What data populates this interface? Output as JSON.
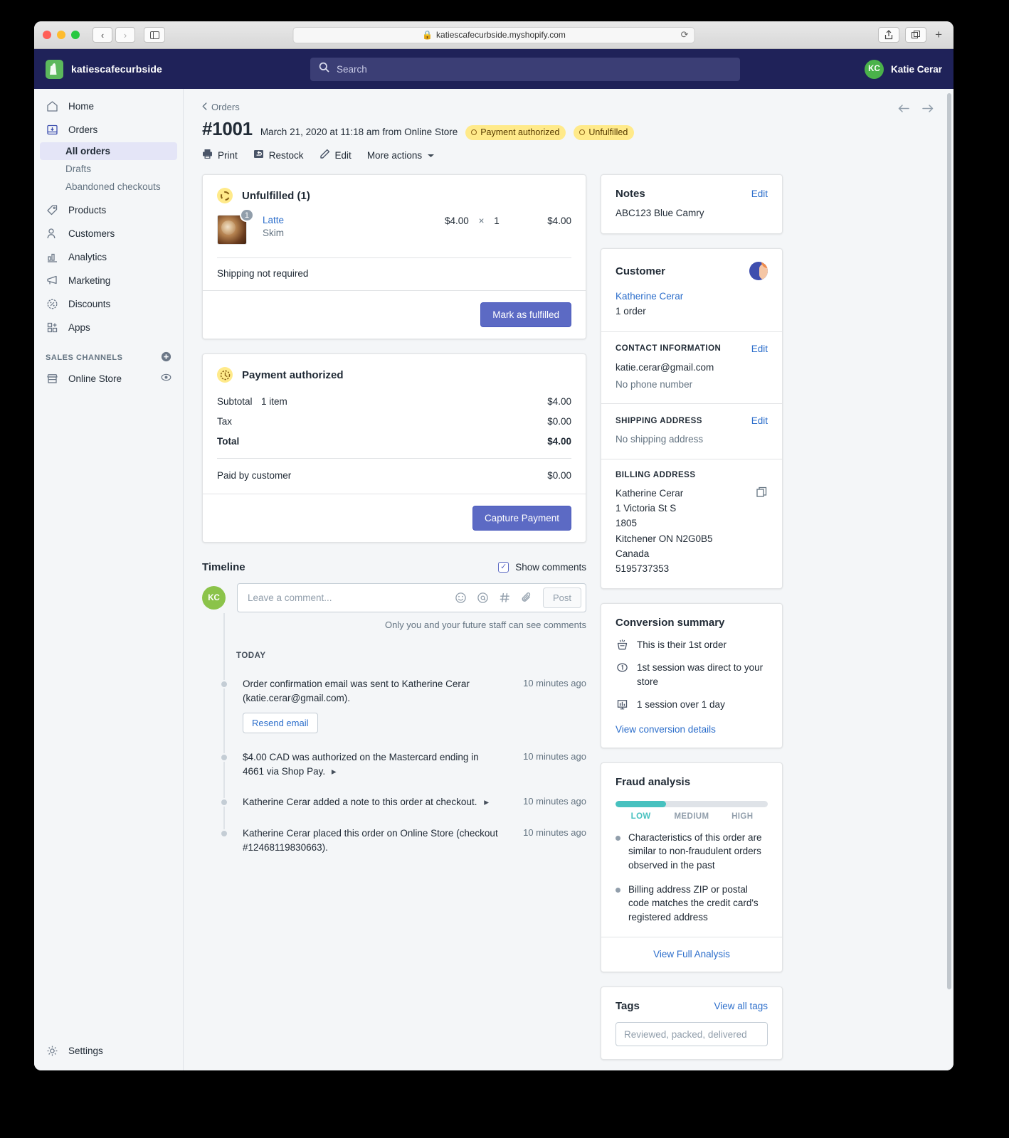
{
  "browser": {
    "url": "katiescafecurbside.myshopify.com",
    "lock_icon": "lock-icon",
    "reload_icon": "reload-icon",
    "back_icon": "chevron-left-icon",
    "forward_icon": "chevron-right-icon",
    "sidebar_icon": "sidebar-toggle-icon",
    "share_icon": "share-icon",
    "tabs_icon": "tab-overview-icon",
    "new_tab_icon": "plus-icon"
  },
  "topbar": {
    "store_name": "katiescafecurbside",
    "search_placeholder": "Search",
    "search_icon": "search-icon",
    "user_initials": "KC",
    "user_name": "Katie Cerar",
    "logo_icon": "shopify-bag-icon"
  },
  "sidebar": {
    "items": [
      {
        "label": "Home",
        "icon": "home-icon"
      },
      {
        "label": "Orders",
        "icon": "orders-inbox-icon"
      },
      {
        "label": "Products",
        "icon": "tag-icon"
      },
      {
        "label": "Customers",
        "icon": "person-icon"
      },
      {
        "label": "Analytics",
        "icon": "bar-chart-icon"
      },
      {
        "label": "Marketing",
        "icon": "megaphone-icon"
      },
      {
        "label": "Discounts",
        "icon": "discount-badge-icon"
      },
      {
        "label": "Apps",
        "icon": "apps-grid-icon"
      }
    ],
    "sub_items": [
      {
        "label": "All orders",
        "active": true
      },
      {
        "label": "Drafts",
        "active": false
      },
      {
        "label": "Abandoned checkouts",
        "active": false
      }
    ],
    "sales_channels_label": "SALES CHANNELS",
    "add_channel_icon": "plus-circle-icon",
    "online_store": {
      "label": "Online Store",
      "icon": "storefront-icon",
      "action_icon": "eye-icon"
    },
    "settings": {
      "label": "Settings",
      "icon": "gear-icon"
    }
  },
  "order": {
    "breadcrumb": "Orders",
    "breadcrumb_icon": "chevron-left-icon",
    "number": "#1001",
    "meta": "March 21, 2020 at 11:18 am from Online Store",
    "badges": [
      {
        "label": "Payment authorized"
      },
      {
        "label": "Unfulfilled"
      }
    ],
    "actions": [
      {
        "label": "Print",
        "icon": "printer-icon"
      },
      {
        "label": "Restock",
        "icon": "restock-arrow-icon"
      },
      {
        "label": "Edit",
        "icon": "pencil-icon"
      },
      {
        "label": "More actions",
        "icon": "chevron-down-icon"
      }
    ],
    "prev_icon": "arrow-left-icon",
    "next_icon": "arrow-right-icon"
  },
  "fulfillment": {
    "title": "Unfulfilled (1)",
    "status_icon": "dashed-circle-icon",
    "line_item": {
      "quantity_badge": "1",
      "title": "Latte",
      "variant": "Skim",
      "unit_price": "$4.00",
      "multiply": "×",
      "quantity": "1",
      "line_total": "$4.00",
      "thumbnail": "latte-photo"
    },
    "shipping_note": "Shipping not required",
    "primary_button": "Mark as fulfilled"
  },
  "payment": {
    "title": "Payment authorized",
    "status_icon": "clock-dashed-icon",
    "rows": [
      {
        "label": "Subtotal",
        "sub": "1 item",
        "amount": "$4.00",
        "bold": false
      },
      {
        "label": "Tax",
        "sub": "",
        "amount": "$0.00",
        "bold": false
      },
      {
        "label": "Total",
        "sub": "",
        "amount": "$4.00",
        "bold": true
      }
    ],
    "paid_label": "Paid by customer",
    "paid_amount": "$0.00",
    "primary_button": "Capture Payment"
  },
  "timeline": {
    "title": "Timeline",
    "show_comments_label": "Show comments",
    "checkbox_checked": true,
    "avatar_initials": "KC",
    "composer_placeholder": "Leave a comment...",
    "composer_icons": [
      "emoji-icon",
      "mention-icon",
      "hashtag-icon",
      "attachment-icon"
    ],
    "post_button": "Post",
    "privacy_note": "Only you and your future staff can see comments",
    "day_label": "TODAY",
    "events": [
      {
        "text": "Order confirmation email was sent to Katherine Cerar (katie.cerar@gmail.com).",
        "time": "10 minutes ago",
        "button": "Resend email"
      },
      {
        "text": "$4.00 CAD was authorized on the Mastercard ending in 4661 via Shop Pay.",
        "time": "10 minutes ago",
        "expand_icon": "caret-right-icon"
      },
      {
        "text": "Katherine Cerar added a note to this order at checkout.",
        "time": "10 minutes ago",
        "expand_icon": "caret-right-icon"
      },
      {
        "text": "Katherine Cerar placed this order on Online Store (checkout #12468119830663).",
        "time": "10 minutes ago"
      }
    ]
  },
  "notes": {
    "title": "Notes",
    "edit_label": "Edit",
    "body": "ABC123 Blue Camry"
  },
  "customer": {
    "title": "Customer",
    "avatar_icon": "customer-avatar-icon",
    "name": "Katherine Cerar",
    "order_count": "1 order",
    "contact_label": "CONTACT INFORMATION",
    "contact_edit": "Edit",
    "email": "katie.cerar@gmail.com",
    "phone": "No phone number",
    "shipping_label": "SHIPPING ADDRESS",
    "shipping_edit": "Edit",
    "shipping_value": "No shipping address",
    "billing_label": "BILLING ADDRESS",
    "billing_copy_icon": "copy-icon",
    "billing_lines": [
      "Katherine Cerar",
      "1 Victoria St S",
      "1805",
      "Kitchener ON N2G0B5",
      "Canada",
      "5195737353"
    ]
  },
  "conversion": {
    "title": "Conversion summary",
    "rows": [
      {
        "text": "This is their 1st order",
        "icon": "first-order-icon"
      },
      {
        "text": "1st session was direct to your store",
        "icon": "session-number-icon"
      },
      {
        "text": "1 session over 1 day",
        "icon": "session-chart-icon"
      }
    ],
    "link": "View conversion details"
  },
  "fraud": {
    "title": "Fraud analysis",
    "level": "LOW",
    "meter_percent": 33,
    "meter_color": "#47c1bf",
    "labels": [
      "LOW",
      "MEDIUM",
      "HIGH"
    ],
    "bullets": [
      "Characteristics of this order are similar to non-fraudulent orders observed in the past",
      "Billing address ZIP or postal code matches the credit card's registered address"
    ],
    "link": "View Full Analysis"
  },
  "tags": {
    "title": "Tags",
    "view_all": "View all tags",
    "placeholder": "Reviewed, packed, delivered"
  }
}
